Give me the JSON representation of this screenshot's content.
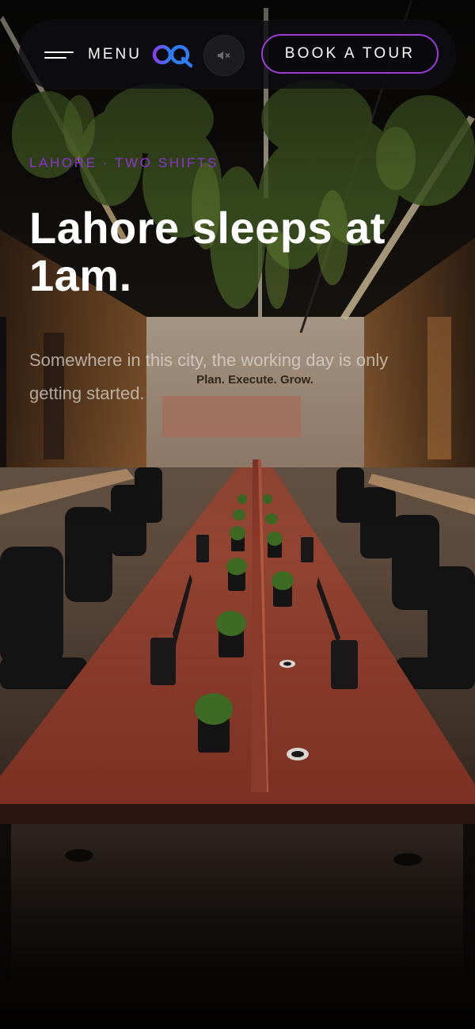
{
  "nav": {
    "menu_label": "MENU",
    "logo_icon": "oq-logo-icon",
    "mute_icon": "speaker-mute-icon",
    "cta_label": "BOOK A TOUR"
  },
  "hero": {
    "eyebrow": "LAHORE · TWO SHIFTS",
    "headline": "Lahore sleeps at 1am.",
    "subtext": "Somewhere in this city, the working day is only getting started.",
    "wall_sign": "Plan. Execute. Grow."
  },
  "colors": {
    "accent_purple": "#8e33d4",
    "cta_border": "#9b3bd8",
    "logo_blue": "#2f7bf2",
    "navbar_bg": "#0e0e12"
  }
}
